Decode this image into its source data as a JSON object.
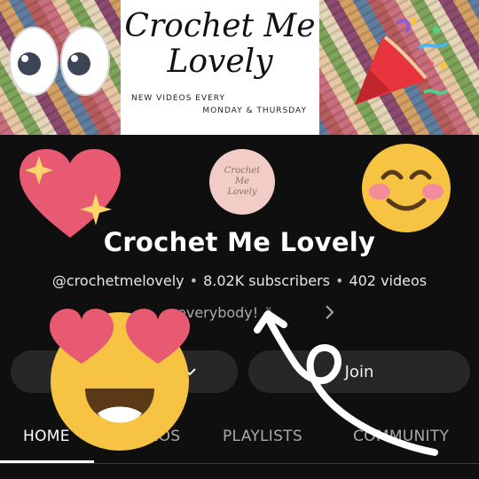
{
  "banner": {
    "logo_title": "Crochet Me Lovely",
    "tagline_line1": "NEW VIDEOS EVERY",
    "tagline_line2": "MONDAY & THURSDAY"
  },
  "channel": {
    "avatar_text": "Crochet Me Lovely",
    "name": "Crochet Me Lovely",
    "handle": "@crochetmelovely",
    "subscribers": "8.02K subscribers",
    "videos": "402 videos",
    "description": "everybody! ✌",
    "separator": "•"
  },
  "buttons": {
    "join_label": "Join"
  },
  "tabs": [
    {
      "label": "HOME",
      "active": true
    },
    {
      "label": "VIDEOS",
      "active": false
    },
    {
      "label": "PLAYLISTS",
      "active": false
    },
    {
      "label": "COMMUNITY",
      "active": false
    }
  ],
  "colors": {
    "background": "#0f0f0f",
    "button_bg": "#272727",
    "avatar_bg": "#f2cdc7",
    "heart": "#e85a71",
    "emoji_yellow": "#f6c343"
  },
  "icons": [
    "eyes-icon",
    "party-popper-icon",
    "sparkling-heart-icon",
    "smiling-face-icon",
    "heart-eyes-face-icon",
    "arrow-drawing",
    "bell-icon",
    "chevron-right-icon"
  ]
}
